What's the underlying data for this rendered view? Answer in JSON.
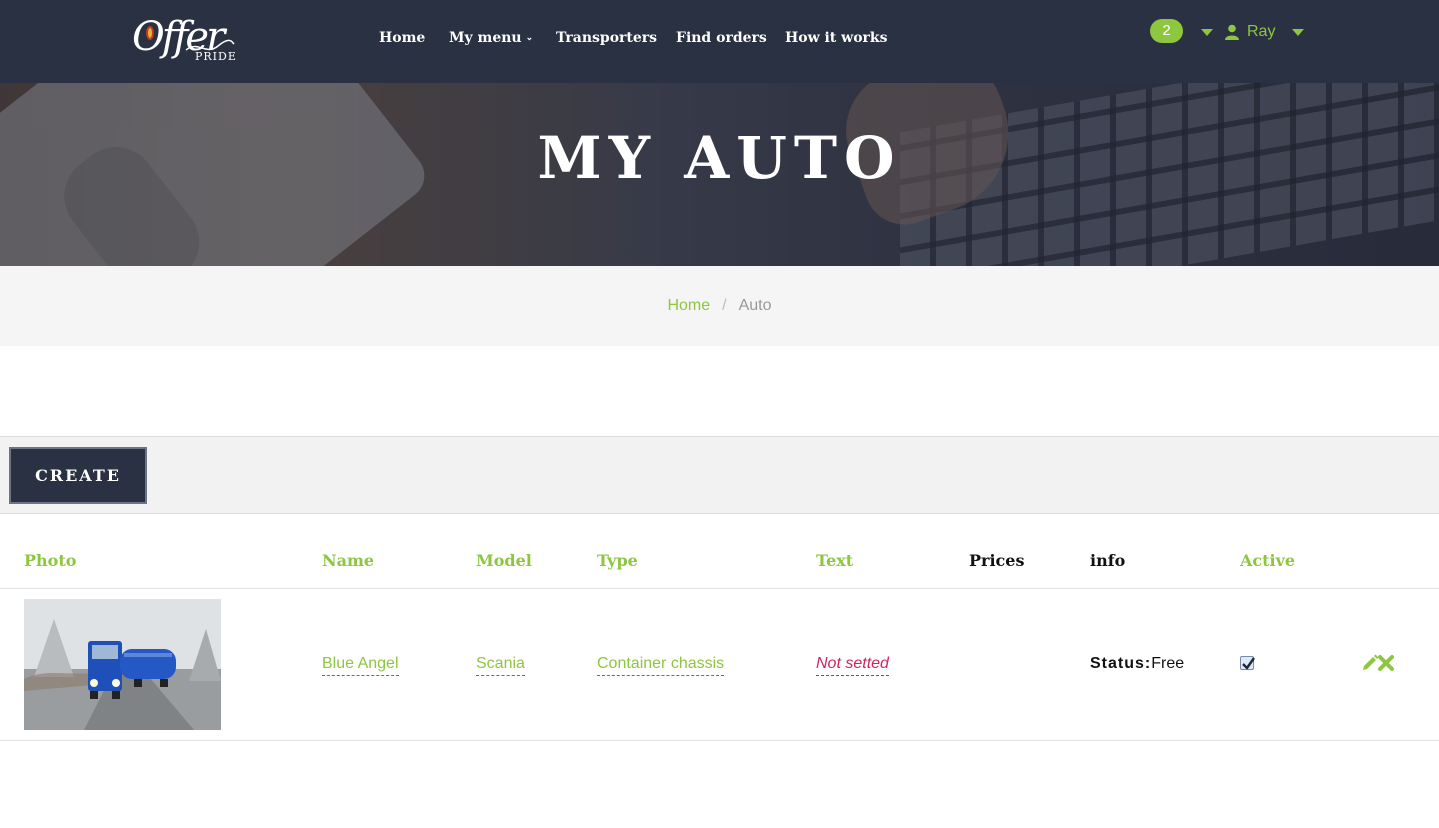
{
  "brand": {
    "logo_script": "Offer",
    "logo_sub": "PRIDE"
  },
  "nav": {
    "items": [
      {
        "label": "Home"
      },
      {
        "label": "My menu",
        "has_dropdown": true
      },
      {
        "label": "Transporters"
      },
      {
        "label": "Find orders"
      },
      {
        "label": "How it works"
      }
    ],
    "notifications_count": "2",
    "user_name": "Ray"
  },
  "hero": {
    "title": "MY AUTO"
  },
  "breadcrumb": {
    "home": "Home",
    "separator": "/",
    "current": "Auto"
  },
  "toolbar": {
    "create_label": "CREATE"
  },
  "table": {
    "columns": {
      "photo": "Photo",
      "name": "Name",
      "model": "Model",
      "type": "Type",
      "text": "Text",
      "prices": "Prices",
      "info": "info",
      "active": "Active"
    },
    "rows": [
      {
        "photo": "truck-photo",
        "name": "Blue Angel",
        "model": "Scania",
        "type": "Container chassis",
        "text": "Not setted",
        "prices": "",
        "status_label": "Status:",
        "status_value": "Free",
        "active": true
      }
    ]
  },
  "colors": {
    "accent": "#8dc63f",
    "navbar": "#2a3142",
    "empty_value": "#d0245c"
  },
  "icons": [
    "user-icon",
    "caret-down-icon",
    "pencil-icon",
    "delete-icon",
    "checkbox-icon"
  ]
}
